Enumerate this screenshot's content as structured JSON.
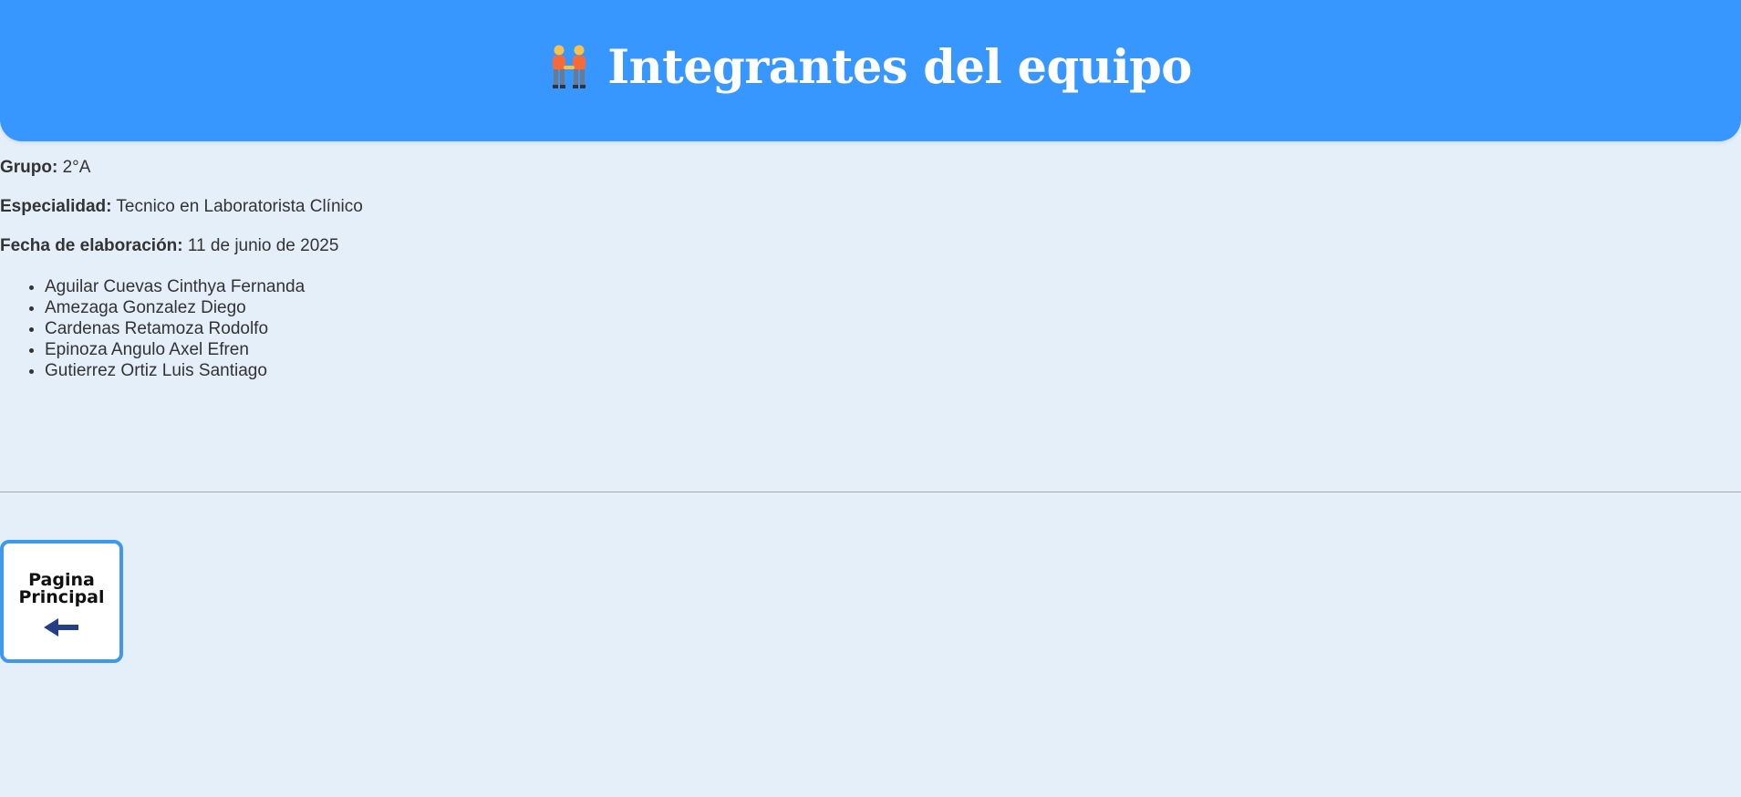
{
  "header": {
    "title": "Integrantes del equipo",
    "icon": "people-holding-hands-icon",
    "background": "#3797ff"
  },
  "info": {
    "grupo_label": "Grupo:",
    "grupo_value": " 2°A",
    "especialidad_label": "Especialidad:",
    "especialidad_value": " Tecnico en Laboratorista Clínico",
    "fecha_label": "Fecha de elaboración:",
    "fecha_value": " 11 de junio de 2025"
  },
  "members": [
    "Aguilar Cuevas Cinthya Fernanda",
    "Amezaga Gonzalez Diego",
    "Cardenas Retamoza Rodolfo",
    "Epinoza Angulo Axel Efren",
    "Gutierrez Ortiz Luis Santiago"
  ],
  "home_button": {
    "label": "Pagina Principal",
    "icon": "arrow-left-icon",
    "border_color": "#3d98ee"
  }
}
